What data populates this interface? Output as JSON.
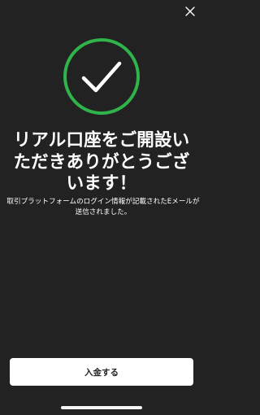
{
  "header": {
    "close_icon": "close-icon"
  },
  "status": {
    "icon": "check-circle-icon",
    "accent_color": "#2fb34a"
  },
  "content": {
    "headline": "リアル口座をご開設いただきありがとうございます！",
    "message": "取引プラットフォームのログイン情報が記載されたEメールが送信されました。"
  },
  "footer": {
    "deposit_button_label": "入金する"
  },
  "colors": {
    "background": "#222222",
    "button_background": "#ffffff",
    "button_text": "#222222"
  }
}
